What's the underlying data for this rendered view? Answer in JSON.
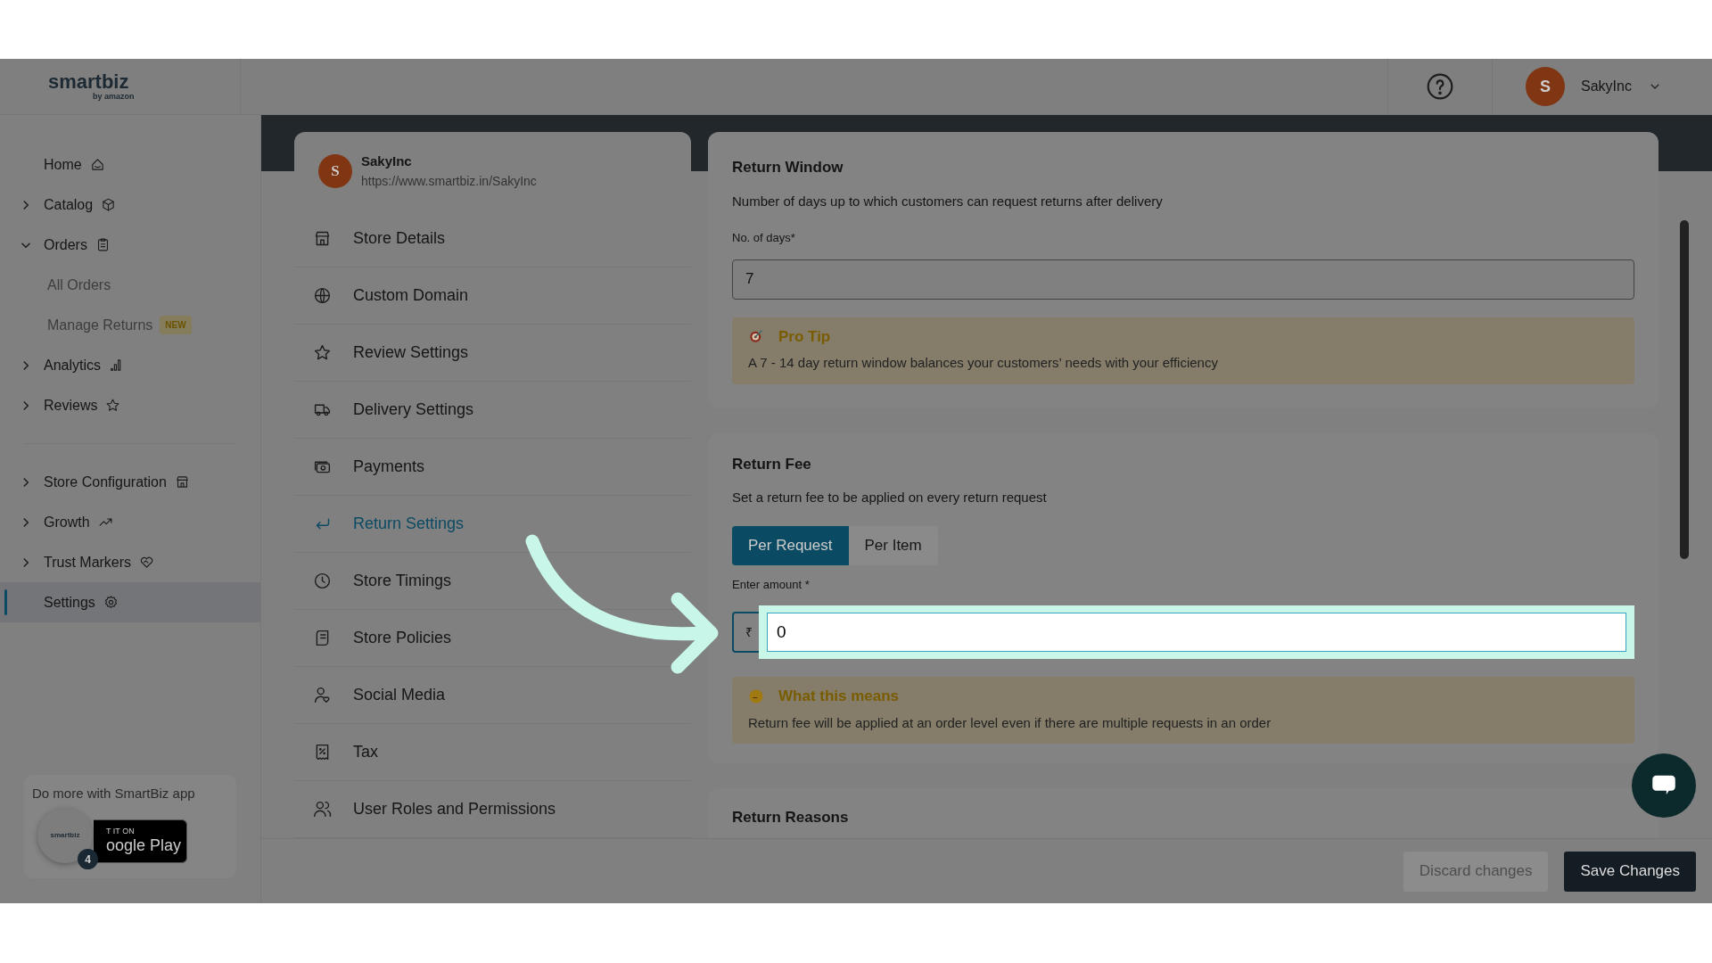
{
  "header": {
    "logo": {
      "name": "smartbiz",
      "tagline": "by amazon"
    },
    "user": {
      "initial": "S",
      "name": "SakyInc"
    }
  },
  "sidebar": {
    "sections": [
      [
        {
          "label": "Home",
          "kind": "link",
          "selected": false
        },
        {
          "label": "Catalog",
          "kind": "group",
          "expanded": false,
          "selected": false
        },
        {
          "label": "Orders",
          "kind": "group",
          "expanded": true,
          "selected": false,
          "children": [
            {
              "label": "All Orders"
            },
            {
              "label": "Manage Returns",
              "badge": "NEW"
            }
          ]
        },
        {
          "label": "Analytics",
          "kind": "group",
          "expanded": false,
          "selected": false
        },
        {
          "label": "Reviews",
          "kind": "group",
          "expanded": false,
          "selected": false
        }
      ],
      [
        {
          "label": "Store Configuration",
          "kind": "group",
          "expanded": false,
          "selected": false
        },
        {
          "label": "Growth",
          "kind": "group",
          "expanded": false,
          "selected": false
        },
        {
          "label": "Trust Markers",
          "kind": "group",
          "expanded": false,
          "selected": false
        },
        {
          "label": "Settings",
          "kind": "link",
          "selected": true
        }
      ]
    ],
    "promo": {
      "text": "Do more with SmartBiz app",
      "store_line1": "T IT ON",
      "store_line2": "oogle Play",
      "app_logo": "smartbiz",
      "count": "4"
    }
  },
  "store": {
    "initial": "S",
    "name": "SakyInc",
    "url": "https://www.smartbiz.in/SakyInc"
  },
  "settings_menu": [
    {
      "label": "Store Details",
      "selected": false
    },
    {
      "label": "Custom Domain",
      "selected": false
    },
    {
      "label": "Review Settings",
      "selected": false
    },
    {
      "label": "Delivery Settings",
      "selected": false
    },
    {
      "label": "Payments",
      "selected": false
    },
    {
      "label": "Return Settings",
      "selected": true
    },
    {
      "label": "Store Timings",
      "selected": false
    },
    {
      "label": "Store Policies",
      "selected": false
    },
    {
      "label": "Social Media",
      "selected": false
    },
    {
      "label": "Tax",
      "selected": false
    },
    {
      "label": "User Roles and Permissions",
      "selected": false
    }
  ],
  "return_window": {
    "title": "Return Window",
    "description": "Number of days up to which customers can request returns after delivery",
    "field_label": "No. of days*",
    "value": "7",
    "tip": {
      "title": "Pro Tip",
      "text": "A 7 - 14 day return window balances your customers’ needs with your efficiency"
    }
  },
  "return_fee": {
    "title": "Return Fee",
    "description": "Set a return fee to be applied on every return request",
    "options": [
      {
        "label": "Per Request",
        "selected": true
      },
      {
        "label": "Per Item",
        "selected": false
      }
    ],
    "amount_label": "Enter amount *",
    "currency": "₹",
    "value": "0",
    "note": {
      "title": "What this means",
      "text": "Return fee will be applied at an order level even if there are multiple requests in an order"
    }
  },
  "return_reasons": {
    "title": "Return Reasons"
  },
  "footer": {
    "buttons": [
      {
        "label": "Discard changes",
        "disabled": true
      },
      {
        "label": "Save Changes",
        "disabled": false
      }
    ]
  }
}
